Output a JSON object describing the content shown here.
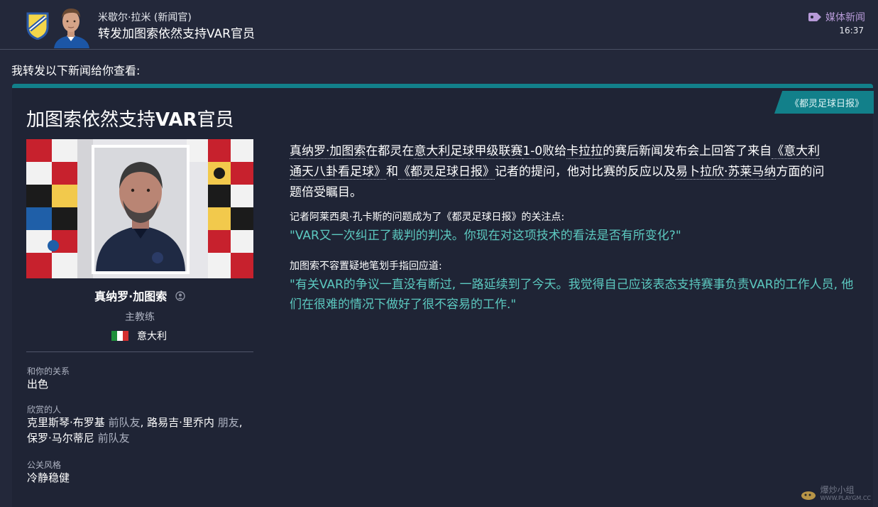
{
  "header": {
    "sender": "米歇尔·拉米 (新闻官)",
    "subject": "转发加图索依然支持VAR官员",
    "category": "媒体新闻",
    "time": "16:37"
  },
  "intro": "我转发以下新闻给你查看:",
  "article": {
    "source": "《都灵足球日报》",
    "title_prefix": "加图索依然支持",
    "title_bold": "VAR",
    "title_suffix": "官员",
    "lead_1": "真纳罗·加图索",
    "lead_2": "在都灵在",
    "lead_3": "意大利足球甲级联赛",
    "lead_4": "1-0",
    "lead_5": "败给",
    "lead_6": "卡拉拉",
    "lead_7": "的赛后新闻发布会上回答了来自",
    "lead_8": "《意大利通天八卦看足球》",
    "lead_9": "和",
    "lead_10": "《都灵足球日报》",
    "lead_11": "记者的提问，他对比赛的反应以及",
    "lead_12": "易卜拉欣·苏莱马纳",
    "lead_13": "方面的问题倍受瞩目。",
    "question_intro": "记者阿莱西奥·孔卡斯的问题成为了《都灵足球日报》的关注点:",
    "question": "\"VAR又一次纠正了裁判的判决。你现在对这项技术的看法是否有所变化?\"",
    "answer_intro": "加图索不容置疑地笔划手指回应道:",
    "answer": "\"有关VAR的争议一直没有断过, 一路延续到了今天。我觉得自己应该表态支持赛事负责VAR的工作人员, 他们在很难的情况下做好了很不容易的工作.\""
  },
  "person": {
    "name": "真纳罗·加图索",
    "role": "主教练",
    "nation": "意大利",
    "relationship_label": "和你的关系",
    "relationship_value": "出色",
    "favored_label": "欣赏的人",
    "favored_1": "克里斯琴·布罗基",
    "favored_1_rel": "前队友",
    "favored_2": "路易吉·里乔内",
    "favored_2_rel": "朋友",
    "favored_3": "保罗·马尔蒂尼",
    "favored_3_rel": "前队友",
    "media_style_label": "公关风格",
    "media_style_value": "冷静稳健"
  },
  "watermark": {
    "text": "爆炒小组",
    "url": "WWW.PLAYGM.CC"
  },
  "colors": {
    "accent": "#12808a",
    "quote": "#5cc9c0",
    "category": "#b79ad8"
  }
}
